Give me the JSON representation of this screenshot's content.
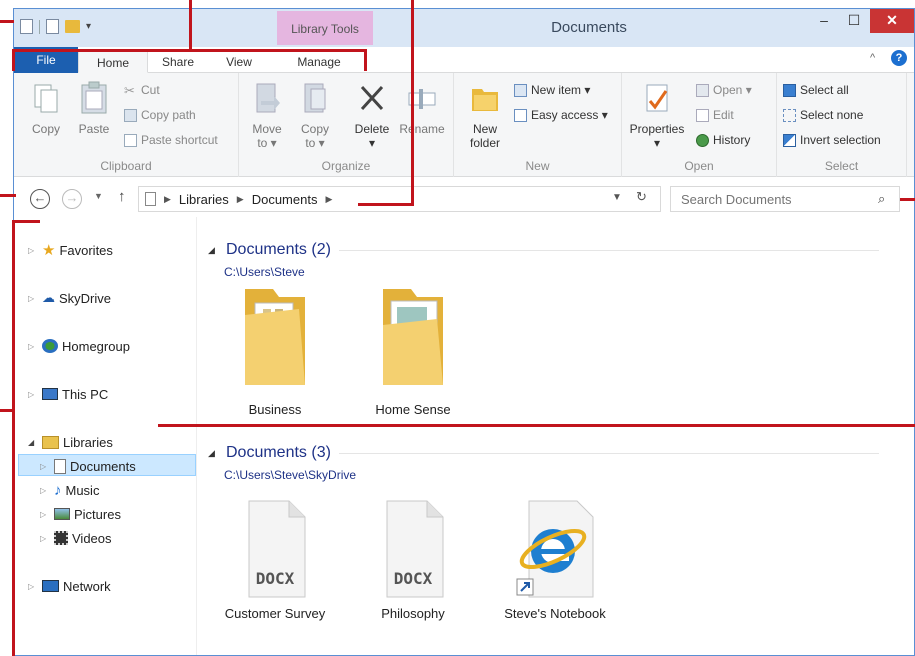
{
  "window": {
    "title": "Documents",
    "context_tab": "Library Tools",
    "controls": {
      "minimize": "–",
      "maximize": "☐",
      "close": "✕"
    }
  },
  "tabs": [
    {
      "label": "File"
    },
    {
      "label": "Home"
    },
    {
      "label": "Share"
    },
    {
      "label": "View"
    },
    {
      "label": "Manage"
    }
  ],
  "ribbon": {
    "clipboard": {
      "label": "Clipboard",
      "copy": "Copy",
      "paste": "Paste",
      "cut": "Cut",
      "copy_path": "Copy path",
      "paste_shortcut": "Paste shortcut"
    },
    "organize": {
      "label": "Organize",
      "move_to": "Move",
      "move_to_2": "to ▾",
      "copy_to": "Copy",
      "copy_to_2": "to ▾",
      "delete": "Delete",
      "delete_arrow": "▾",
      "rename": "Rename"
    },
    "new": {
      "label": "New",
      "new_folder": "New",
      "new_folder_2": "folder",
      "new_item": "New item ▾",
      "easy_access": "Easy access ▾"
    },
    "open": {
      "label": "Open",
      "properties": "Properties",
      "properties_arrow": "▾",
      "open": "Open ▾",
      "edit": "Edit",
      "history": "History"
    },
    "select": {
      "label": "Select",
      "select_all": "Select all",
      "select_none": "Select none",
      "invert_selection": "Invert selection"
    }
  },
  "address": {
    "crumbs": [
      "Libraries",
      "Documents"
    ],
    "search_placeholder": "Search Documents"
  },
  "nav": {
    "favorites": "Favorites",
    "skydrive": "SkyDrive",
    "homegroup": "Homegroup",
    "this_pc": "This PC",
    "libraries": "Libraries",
    "documents": "Documents",
    "music": "Music",
    "pictures": "Pictures",
    "videos": "Videos",
    "network": "Network"
  },
  "content": {
    "section1": {
      "title": "Documents (2)",
      "path": "C:\\Users\\Steve",
      "items": [
        "Business",
        "Home Sense"
      ]
    },
    "section2": {
      "title": "Documents (3)",
      "path": "C:\\Users\\Steve\\SkyDrive",
      "items": [
        "Customer Survey",
        "Philosophy",
        "Steve's Notebook"
      ],
      "doc_badge": "DOCX"
    }
  }
}
